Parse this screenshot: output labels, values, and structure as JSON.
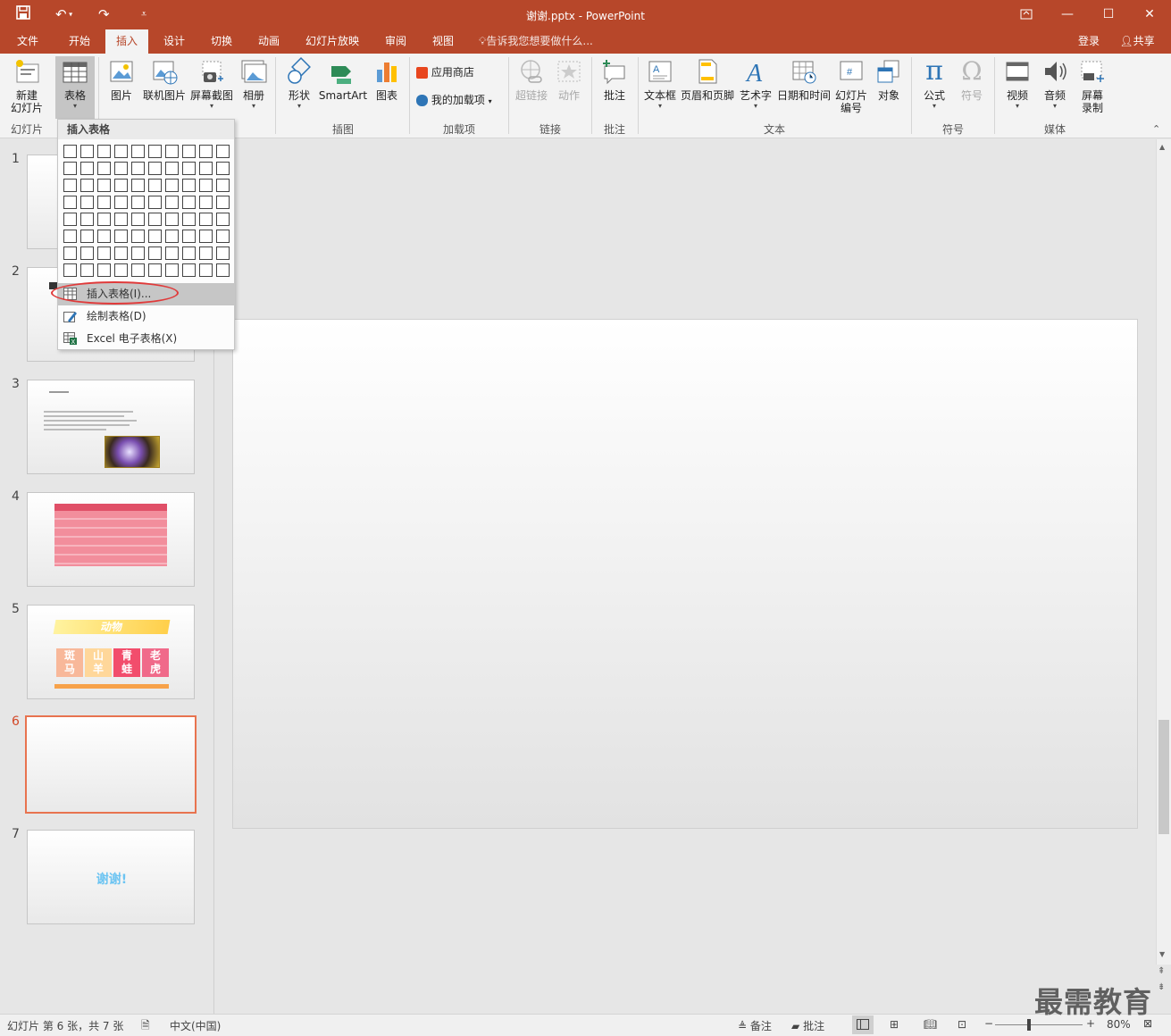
{
  "window": {
    "title": "谢谢.pptx - PowerPoint",
    "minimize_icon": "minimize-icon",
    "maximize_icon": "maximize-icon",
    "close_icon": "close-icon"
  },
  "menu_tabs": [
    "文件",
    "开始",
    "插入",
    "设计",
    "切换",
    "动画",
    "幻灯片放映",
    "审阅",
    "视图"
  ],
  "active_tab": "插入",
  "tell_me": "告诉我您想要做什么...",
  "account": {
    "login": "登录",
    "share": "共享"
  },
  "ribbon": {
    "new_slide": "新建\n幻灯片",
    "table": "表格",
    "picture": "图片",
    "online_picture": "联机图片",
    "screenshot": "屏幕截图",
    "album": "相册",
    "shapes": "形状",
    "smartart": "SmartArt",
    "chart": "图表",
    "store": "应用商店",
    "my_addins": "我的加载项",
    "hyperlink": "超链接",
    "action": "动作",
    "comment": "批注",
    "textbox": "文本框",
    "header_footer": "页眉和页脚",
    "wordart": "艺术字",
    "datetime": "日期和时间",
    "slide_number": "幻灯片\n编号",
    "object": "对象",
    "equation": "公式",
    "symbol": "符号",
    "video": "视频",
    "audio": "音频",
    "screen_recording": "屏幕\n录制",
    "groups": {
      "slides": "幻灯片",
      "illustrations": "插图",
      "addins": "加载项",
      "links": "链接",
      "comments": "批注",
      "text": "文本",
      "symbols": "符号",
      "media": "媒体"
    }
  },
  "dropdown": {
    "header": "插入表格",
    "items": [
      "插入表格(I)...",
      "绘制表格(D)",
      "Excel 电子表格(X)"
    ]
  },
  "slides": {
    "numbers": [
      "1",
      "2",
      "3",
      "4",
      "5",
      "6",
      "7"
    ],
    "selected": "6",
    "thumb5": {
      "title": "动物",
      "cells": [
        "斑\n马",
        "山\n羊",
        "青\n蛙",
        "老\n虎"
      ]
    },
    "thumb7": {
      "text": "谢谢!"
    }
  },
  "status": {
    "slide_info": "幻灯片 第 6 张，共 7 张",
    "language": "中文(中国)",
    "notes": "备注",
    "comments": "批注",
    "zoom": "80%"
  },
  "watermark": "最需教育",
  "colors": {
    "accent": "#b7472a",
    "selection": "#e8734f"
  }
}
